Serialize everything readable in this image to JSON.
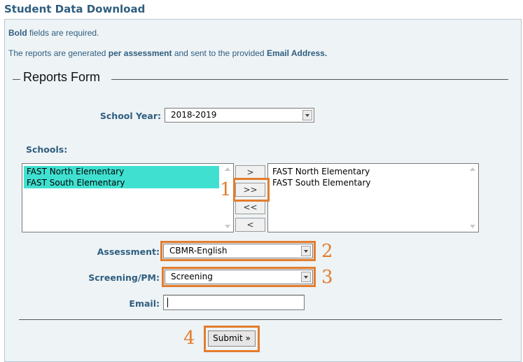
{
  "header": {
    "title": "Student Data Download"
  },
  "info": {
    "line1_bold": "Bold",
    "line1_rest": " fields are required.",
    "line2_pre": "The reports are generated ",
    "line2_bold1": "per assessment",
    "line2_mid": " and sent to the provided ",
    "line2_bold2": "Email Address."
  },
  "form": {
    "legend": "Reports Form",
    "school_year": {
      "label": "School Year:",
      "value": "2018-2019"
    },
    "schools": {
      "label": "Schools:",
      "available": [
        "FAST North Elementary",
        "FAST South Elementary"
      ],
      "selected": [
        "FAST North Elementary",
        "FAST South Elementary"
      ],
      "buttons": {
        "add": ">",
        "add_all": ">>",
        "remove_all": "<<",
        "remove": "<"
      }
    },
    "assessment": {
      "label": "Assessment:",
      "value": "CBMR-English"
    },
    "screening": {
      "label": "Screening/PM:",
      "value": "Screening"
    },
    "email": {
      "label": "Email:",
      "value": ""
    },
    "submit_label": "Submit »"
  },
  "callouts": {
    "n1": "1",
    "n2": "2",
    "n3": "3",
    "n4": "4"
  },
  "colors": {
    "accent": "#e37d2d",
    "title": "#2f5e7f",
    "selection": "#40e0d0"
  }
}
